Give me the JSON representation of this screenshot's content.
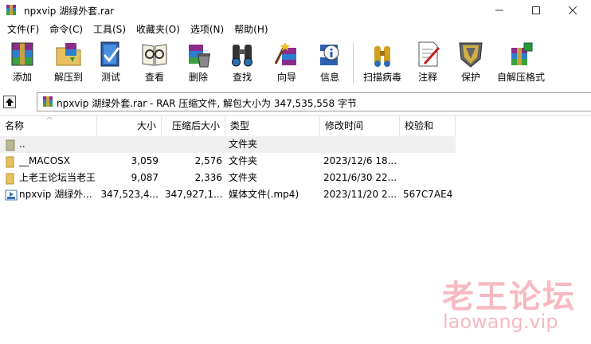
{
  "window": {
    "title": "npxvip 湖绿外套.rar"
  },
  "menu": [
    "文件(F)",
    "命令(C)",
    "工具(S)",
    "收藏夹(O)",
    "选项(N)",
    "帮助(H)"
  ],
  "toolbar": [
    {
      "label": "添加",
      "icon": "add-archive-icon"
    },
    {
      "label": "解压到",
      "icon": "extract-to-icon"
    },
    {
      "label": "测试",
      "icon": "test-icon"
    },
    {
      "label": "查看",
      "icon": "view-icon"
    },
    {
      "label": "删除",
      "icon": "delete-icon"
    },
    {
      "label": "查找",
      "icon": "find-icon"
    },
    {
      "label": "向导",
      "icon": "wizard-icon"
    },
    {
      "label": "信息",
      "icon": "info-icon"
    },
    {
      "label": "扫描病毒",
      "icon": "virus-scan-icon"
    },
    {
      "label": "注释",
      "icon": "comment-icon"
    },
    {
      "label": "保护",
      "icon": "protect-icon"
    },
    {
      "label": "自解压格式",
      "icon": "sfx-icon"
    }
  ],
  "address": {
    "text": "npxvip 湖绿外套.rar - RAR 压缩文件, 解包大小为 347,535,558 字节"
  },
  "columns": [
    "名称",
    "大小",
    "压缩后大小",
    "类型",
    "修改时间",
    "校验和"
  ],
  "rows": [
    {
      "name": "..",
      "size": "",
      "packed": "",
      "type": "文件夹",
      "modified": "",
      "crc": "",
      "icon": "parent-folder-icon"
    },
    {
      "name": "__MACOSX",
      "size": "3,059",
      "packed": "2,576",
      "type": "文件夹",
      "modified": "2023/12/6 18...",
      "crc": "",
      "icon": "folder-icon"
    },
    {
      "name": "上老王论坛当老王",
      "size": "9,087",
      "packed": "2,336",
      "type": "文件夹",
      "modified": "2021/6/30 22...",
      "crc": "",
      "icon": "folder-icon"
    },
    {
      "name": "npxvip 湖绿外...",
      "size": "347,523,4...",
      "packed": "347,927,1...",
      "type": "媒体文件(.mp4)",
      "modified": "2023/11/20 2...",
      "crc": "567C7AE4",
      "icon": "video-file-icon"
    }
  ],
  "watermark": {
    "cn": "老王论坛",
    "url": "laowang.vip"
  },
  "colors": {
    "folder": "#e8c060",
    "watermark": "#f6b9c2"
  }
}
